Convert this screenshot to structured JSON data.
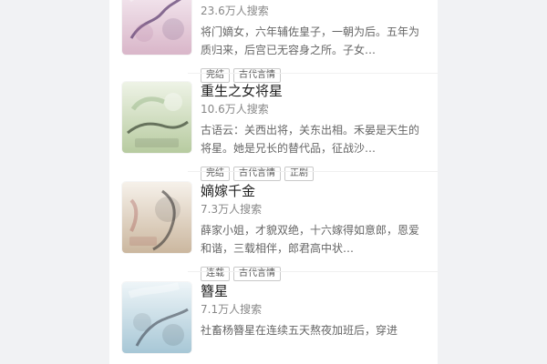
{
  "books": [
    {
      "title": "",
      "searches": "23.6万人搜索",
      "desc": "将门嫡女，六年辅佐皇子，一朝为后。五年为质归来，后宫已无容身之所。子女…",
      "tags": [
        "完结",
        "古代言情"
      ],
      "cover": {
        "colors": [
          "#f7eef4",
          "#d9b6c9",
          "#5a3b6e"
        ],
        "icon": "romance-cover-icon"
      }
    },
    {
      "title": "重生之女将星",
      "searches": "10.6万人搜索",
      "desc": "古语云：关西出将，关东出相。禾晏是天生的将星。她是兄长的替代品，征战沙…",
      "tags": [
        "完结",
        "古代言情",
        "正剧"
      ],
      "cover": {
        "colors": [
          "#eef3e6",
          "#b7cba0",
          "#2f3b2a"
        ],
        "icon": "general-cover-icon"
      }
    },
    {
      "title": "嫡嫁千金",
      "searches": "7.3万人搜索",
      "desc": "薛家小姐，才貌双绝，十六嫁得如意郎，恩爱和谐，三载相伴，郎君高中状…",
      "tags": [
        "连载",
        "古代言情"
      ],
      "cover": {
        "colors": [
          "#f6f1ea",
          "#cbb79f",
          "#2c2a2a"
        ],
        "icon": "bride-cover-icon"
      }
    },
    {
      "title": "簪星",
      "searches": "7.1万人搜索",
      "desc": "社畜杨簪星在连续五天熬夜加班后，穿进",
      "tags": [],
      "cover": {
        "colors": [
          "#eef5f8",
          "#a7c7d6",
          "#2a2e3a"
        ],
        "icon": "star-cover-icon"
      }
    }
  ]
}
